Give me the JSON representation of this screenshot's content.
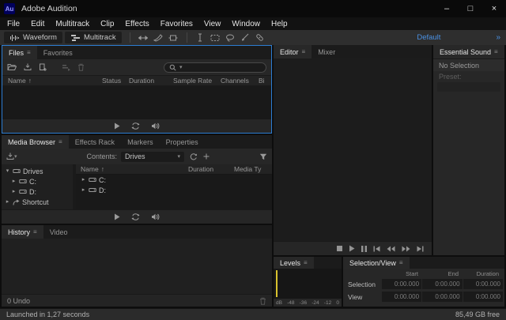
{
  "icons": {
    "panel_menu": "≡",
    "minimize": "–",
    "maximize": "□",
    "close": "×",
    "overflow": "»",
    "expander_open": "▾",
    "expander_closed": "▸",
    "dropdown_caret": "▾"
  },
  "window": {
    "icon_text": "Au",
    "title": "Adobe Audition"
  },
  "menu": {
    "items": [
      "File",
      "Edit",
      "Multitrack",
      "Clip",
      "Effects",
      "Favorites",
      "View",
      "Window",
      "Help"
    ]
  },
  "toolbar": {
    "waveform_label": "Waveform",
    "multitrack_label": "Multitrack",
    "workspace_label": "Default"
  },
  "files_panel": {
    "tabs": [
      {
        "label": "Files"
      },
      {
        "label": "Favorites"
      }
    ],
    "sort_indicator": "↑",
    "columns": [
      "Name",
      "Status",
      "Duration",
      "Sample Rate",
      "Channels",
      "Bi"
    ]
  },
  "media_browser": {
    "tabs": [
      {
        "label": "Media Browser"
      },
      {
        "label": "Effects Rack"
      },
      {
        "label": "Markers"
      },
      {
        "label": "Properties"
      }
    ],
    "contents_label": "Contents:",
    "contents_value": "Drives",
    "sort_indicator": "↑",
    "tree": [
      {
        "label": "Drives"
      },
      {
        "label": "C:"
      },
      {
        "label": "D:"
      },
      {
        "label": "Shortcut"
      }
    ],
    "list_columns": [
      "Name",
      "Duration",
      "Media Ty"
    ],
    "rows": [
      {
        "name": "C:"
      },
      {
        "name": "D:"
      }
    ]
  },
  "history_panel": {
    "tabs": [
      {
        "label": "History"
      },
      {
        "label": "Video"
      }
    ],
    "undo_status": "0 Undo"
  },
  "editor_panel": {
    "tabs": [
      {
        "label": "Editor"
      },
      {
        "label": "Mixer"
      }
    ]
  },
  "essential_sound": {
    "title": "Essential Sound",
    "message": "No Selection",
    "preset_label": "Preset:"
  },
  "levels_panel": {
    "title": "Levels",
    "scale": [
      "dB",
      "-48",
      "-36",
      "-24",
      "-12",
      "0"
    ]
  },
  "selection_view": {
    "title": "Selection/View",
    "columns": [
      "Start",
      "End",
      "Duration"
    ],
    "rows": [
      {
        "label": "Selection",
        "start": "0:00.000",
        "end": "0:00.000",
        "duration": "0:00.000"
      },
      {
        "label": "View",
        "start": "0:00.000",
        "end": "0:00.000",
        "duration": "0:00.000"
      }
    ]
  },
  "status_bar": {
    "left": "Launched in 1,27 seconds",
    "right": "85,49 GB free"
  }
}
